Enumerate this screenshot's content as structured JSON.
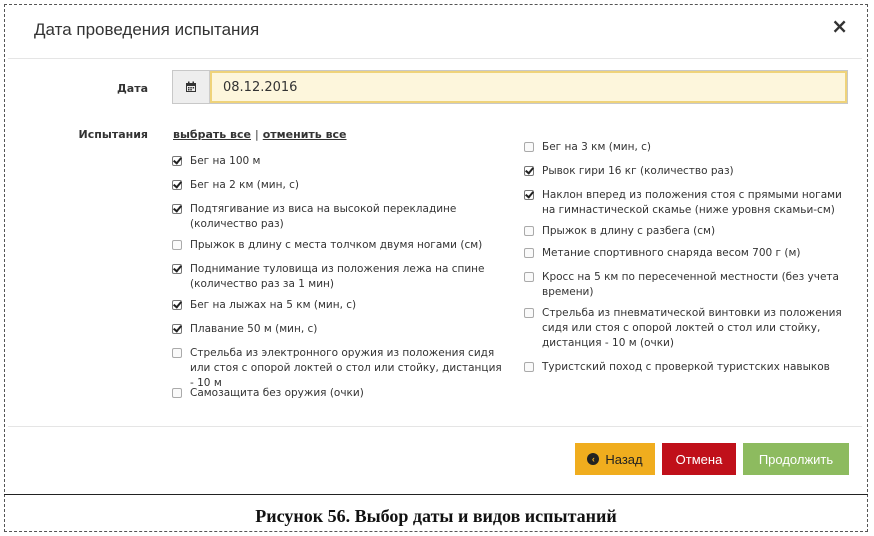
{
  "dialog": {
    "title": "Дата проведения испытания",
    "close_glyph": "×"
  },
  "date": {
    "label": "Дата",
    "icon": "calendar-icon",
    "value": "08.12.2016"
  },
  "tests": {
    "label": "Испытания",
    "select_all": "выбрать все",
    "separator": "|",
    "deselect_all": "отменить все",
    "left_column": [
      {
        "text": "Бег на 100 м",
        "checked": true
      },
      {
        "text": "Бег на 2 км (мин, с)",
        "checked": true
      },
      {
        "text": "Подтягивание из виса на высокой перекладине (количество раз)",
        "checked": true
      },
      {
        "text": "Прыжок в длину с места толчком двумя ногами (см)",
        "checked": false
      },
      {
        "text": "Поднимание туловища из положения лежа на спине (количество раз за 1 мин)",
        "checked": true
      },
      {
        "text": "Бег на лыжах на 5 км (мин, с)",
        "checked": true
      },
      {
        "text": "Плавание 50 м (мин, с)",
        "checked": true
      },
      {
        "text": "Стрельба из электронного оружия из положения сидя или стоя с опорой локтей о стол или стойку, дистанция - 10 м",
        "checked": false
      },
      {
        "text": "Самозащита без оружия (очки)",
        "checked": false
      }
    ],
    "right_column": [
      {
        "text": "Бег на 3 км (мин, с)",
        "checked": false
      },
      {
        "text": "Рывок гири 16 кг (количество раз)",
        "checked": true
      },
      {
        "text": "Наклон вперед из положения стоя с прямыми ногами на гимнастической скамье (ниже уровня скамьи-см)",
        "checked": true
      },
      {
        "text": "Прыжок в длину с разбега (см)",
        "checked": false
      },
      {
        "text": "Метание спортивного снаряда весом 700 г (м)",
        "checked": false
      },
      {
        "text": "Кросс на 5 км по пересеченной местности (без учета времени)",
        "checked": false
      },
      {
        "text": "Стрельба из пневматической винтовки из положения сидя или стоя с опорой локтей о стол или стойку, дистанция - 10 м (очки)",
        "checked": false
      },
      {
        "text": "Туристский поход с проверкой туристских навыков",
        "checked": false
      }
    ]
  },
  "buttons": {
    "back": "Назад",
    "back_icon": "chevron-left-circle-icon",
    "cancel": "Отмена",
    "next": "Продолжить"
  },
  "colors": {
    "back": "#f0ad1e",
    "cancel": "#c0101a",
    "next": "#8dbb5f",
    "date_bg": "#fdf6dc"
  },
  "caption": "Рисунок 56. Выбор даты и видов испытаний"
}
